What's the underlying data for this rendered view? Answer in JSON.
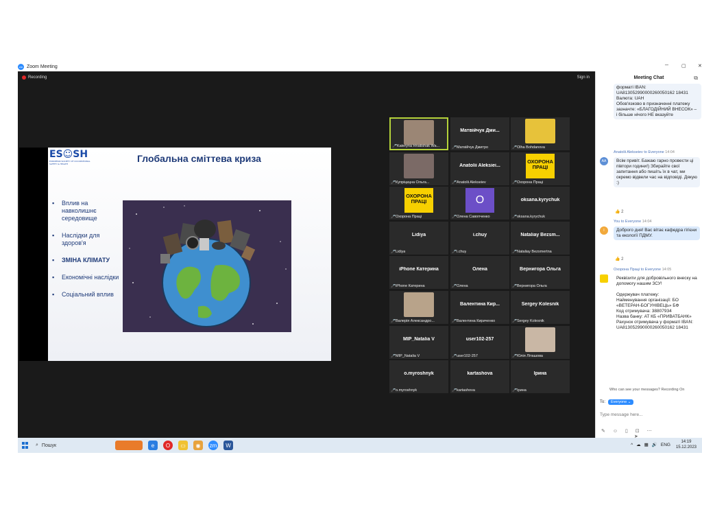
{
  "window": {
    "title": "Zoom Meeting"
  },
  "meeting": {
    "recording_label": "Recording",
    "signin_label": "Sign in"
  },
  "slide": {
    "logo_text": "ES☺SH",
    "logo_subtitle": "EUROPEAN SOCIETY OF OCCUPATIONAL SAFETY & HEALTH",
    "title": "Глобальна сміттева криза",
    "bullets": [
      "Вплив на навколишнє середовище",
      "Наслідки для здоров'я",
      "ЗМІНА КЛІМАТУ",
      "Економічні наслідки",
      "Соціальний вплив"
    ]
  },
  "gallery": [
    {
      "label": "Kateryna Hnatishak Wa...",
      "center": "",
      "kind": "photo",
      "color": "#9b8675"
    },
    {
      "label": "Матвійчук Дмитро",
      "center": "Матвійчук Дми...",
      "kind": "name"
    },
    {
      "label": "Olha Bohdanova",
      "center": "",
      "kind": "photo",
      "color": "#e7c23a"
    },
    {
      "label": "Купріцкцна Ольга...",
      "center": "",
      "kind": "photo",
      "color": "#7b6a66"
    },
    {
      "label": "Anatolii Alekseiev",
      "center": "Anatolii Aleksiei...",
      "kind": "name"
    },
    {
      "label": "Охорона Праці",
      "center": "",
      "kind": "poster",
      "poster": "ОХОРОНА ПРАЦІ"
    },
    {
      "label": "Охорона Праці",
      "center": "",
      "kind": "poster",
      "poster": "ОХОРОНА ПРАЦІ"
    },
    {
      "label": "Олена Савопченко",
      "center": "",
      "kind": "avatar",
      "initial": "O"
    },
    {
      "label": "oksana.kyrychuk",
      "center": "oksana.kyrychuk",
      "kind": "name"
    },
    {
      "label": "Lidiya",
      "center": "Lidiya",
      "kind": "name"
    },
    {
      "label": "i.chuy",
      "center": "i.chuy",
      "kind": "name"
    },
    {
      "label": "Nataliay Bezsmertna",
      "center": "Nataliay Bezsm...",
      "kind": "name"
    },
    {
      "label": "iPhone Катерина",
      "center": "iPhone Катерина",
      "kind": "name"
    },
    {
      "label": "Олена",
      "center": "Олена",
      "kind": "name"
    },
    {
      "label": "Вернигора Ольга",
      "center": "Вернигора Ольга",
      "kind": "name"
    },
    {
      "label": "Валерія Александро...",
      "center": "",
      "kind": "photo",
      "color": "#b8a38a"
    },
    {
      "label": "Валентина Кириченко",
      "center": "Валентина Кир...",
      "kind": "name"
    },
    {
      "label": "Sergey Kolesnik",
      "center": "Sergey Kolesnik",
      "kind": "name"
    },
    {
      "label": "MIP_Natalia V",
      "center": "MIP_Natalia V",
      "kind": "name"
    },
    {
      "label": "user102-257",
      "center": "user102-257",
      "kind": "name"
    },
    {
      "label": "Юлія Літашова",
      "center": "",
      "kind": "photo",
      "color": "#c9b7a5"
    },
    {
      "label": "o.myroshnyk",
      "center": "o.myroshnyk",
      "kind": "name"
    },
    {
      "label": "kartashova",
      "center": "kartashova",
      "kind": "name"
    },
    {
      "label": "Ірина",
      "center": "Ірина",
      "kind": "name"
    }
  ],
  "chat": {
    "title": "Meeting Chat",
    "msg1_text": "форматі IBAN: UA813052990000260050162 18431\nВалюта: UAH\nОбов'язково в призначенні платежу зазначте: «БЛАГОДІЙНИЙ ВНЕСОК» – і більше нічого НЕ вказуйте",
    "msg2_sender": "Anatolii Alekseiev to Everyone",
    "msg2_time": "14:04",
    "msg2_avatar": "AA",
    "msg2_text": "Всім привіт. Бажаю гарно провести ці півтори години!) Збирайте свої запитання або пишіть їх в чат, ми окремо відвели час на відповіді. Дякую :)",
    "msg2_react": "👍 2",
    "msg3_sender": "You to Everyone",
    "msg3_time": "14:04",
    "msg3_avatar": "I",
    "msg3_text": "Доброго дня! Вас вітає кафедра гігієни та екології ПДМУ.",
    "msg3_react": "👍 2",
    "msg4_sender": "Охорона Праці to Everyone",
    "msg4_time": "14:05",
    "msg4_text": "Реквізити для добровільного внеску на допомогу нашим ЗСУ!\n\nОдержувач платежу:\nНайменування організації: БО «ВЕТЕРАН-БОГУНІВЕЦЬ» БФ\nКод отримувача: 38807934\nНазва банку: АТ КБ «ПРИВАТБАНК»\nРахунок отримувача у форматі IBAN: UA813052990000260050162 18431",
    "who_can_see": "Who can see your messages? Recording On",
    "to_label": "To:",
    "to_value": "Everyone",
    "input_placeholder": "Type message here..."
  },
  "taskbar": {
    "search_label": "Пошук",
    "lang": "ENG",
    "time": "14:19",
    "date": "15.12.2023"
  }
}
